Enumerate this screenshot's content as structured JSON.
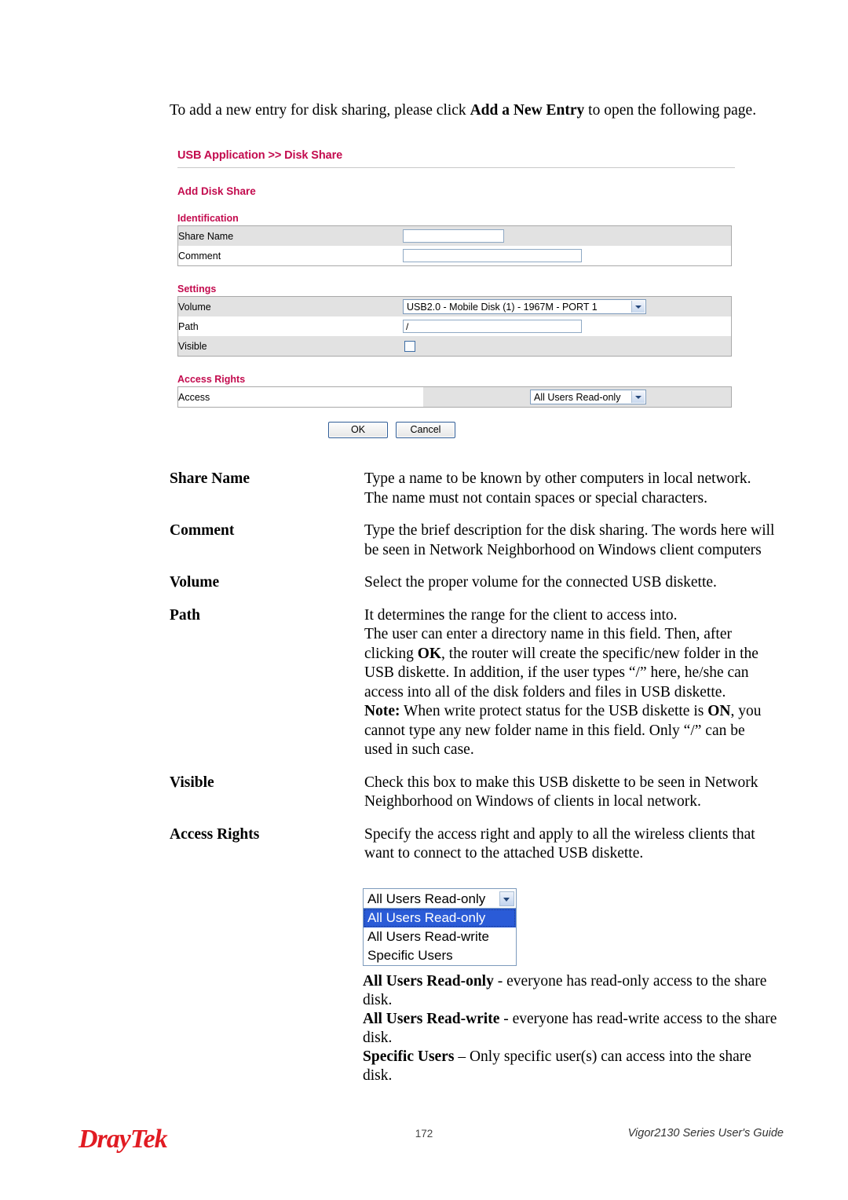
{
  "intro": {
    "before": "To add a new entry for disk sharing, please click ",
    "emphasis": "Add a New Entry",
    "after": " to open the following page."
  },
  "router_ui": {
    "breadcrumb": "USB Application >> Disk Share",
    "page_heading": "Add Disk Share",
    "sections": {
      "identification": {
        "label": "Identification",
        "rows": [
          {
            "label": "Share Name",
            "value": "",
            "type": "text"
          },
          {
            "label": "Comment",
            "value": "",
            "type": "text"
          }
        ]
      },
      "settings": {
        "label": "Settings",
        "rows": [
          {
            "label": "Volume",
            "value": "USB2.0   - Mobile Disk      (1) - 1967M - PORT 1",
            "type": "select"
          },
          {
            "label": "Path",
            "value": "/",
            "type": "text"
          },
          {
            "label": "Visible",
            "value": "",
            "type": "checkbox",
            "checked": false
          }
        ]
      },
      "access_rights": {
        "label": "Access Rights",
        "rows": [
          {
            "label": "Access",
            "value": "All Users Read-only",
            "type": "select"
          }
        ]
      }
    },
    "buttons": {
      "ok": "OK",
      "cancel": "Cancel"
    },
    "colors": {
      "heading": "#C30B4E",
      "row_shade": "#e2e2e2",
      "border": "#a9a9a9",
      "input_border": "#8fa9c4",
      "button_border": "#2f5c96"
    }
  },
  "definitions": [
    {
      "term": "Share Name",
      "desc": "Type a name to be known by other computers in local network. The name must not contain spaces or special characters."
    },
    {
      "term": "Comment",
      "desc": "Type the brief description for the disk sharing. The words here will be seen in Network Neighborhood on Windows client computers"
    },
    {
      "term": "Volume",
      "desc": "Select the proper volume for the connected USB diskette."
    },
    {
      "term": "Path",
      "desc_line1": "It determines the range for the client to access into.",
      "desc_line2a": "The user can enter a directory name in this field. Then, after clicking ",
      "desc_line2b": "OK",
      "desc_line2c": ", the router will create the specific/new folder in the USB diskette. In addition, if the user types “/” here, he/she can access into all of the disk folders and files in USB diskette.",
      "note_label": "Note:",
      "note_a": " When write protect status for the USB diskette is ",
      "note_b": "ON",
      "note_c": ", you cannot type any new folder name in this field. Only “/” can be used in such case."
    },
    {
      "term": "Visible",
      "desc": "Check this box to make this USB diskette to be seen in Network Neighborhood on Windows of clients in local network."
    },
    {
      "term": "Access Rights",
      "desc": "Specify the access right and apply to all the wireless clients that want to connect to the attached USB diskette."
    }
  ],
  "dropdown_illustration": {
    "selected_value": "All Users Read-only",
    "options": [
      "All Users Read-only",
      "All Users Read-write",
      "Specific Users"
    ],
    "highlighted_index": 0,
    "highlight_color": "#2a5bd7"
  },
  "access_notes": [
    {
      "term": "All Users Read-only",
      "sep": " - ",
      "desc": "everyone has read-only access to the share disk."
    },
    {
      "term": "All Users Read-write",
      "sep": " - ",
      "desc": "everyone has read-write access to the share disk."
    },
    {
      "term": "Specific Users",
      "sep": " – ",
      "desc": "Only specific user(s) can access into the share disk."
    }
  ],
  "footer": {
    "logo_dray": "Dray",
    "logo_tek": "Tek",
    "page_number": "172",
    "guide": "Vigor2130 Series User's Guide",
    "logo_color": "#E11B22"
  }
}
